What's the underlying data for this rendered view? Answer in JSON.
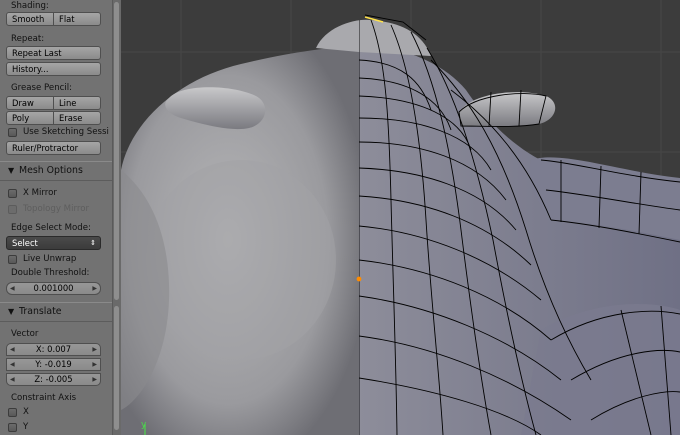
{
  "toolshelf": {
    "shading": {
      "label": "Shading:",
      "smooth": "Smooth",
      "flat": "Flat"
    },
    "repeat": {
      "label": "Repeat:",
      "repeat_last": "Repeat Last",
      "history": "History..."
    },
    "grease_pencil": {
      "label": "Grease Pencil:",
      "draw": "Draw",
      "line": "Line",
      "poly": "Poly",
      "erase": "Erase",
      "use_sketching": "Use Sketching Sessi",
      "ruler": "Ruler/Protractor"
    },
    "mesh_options": {
      "title": "Mesh Options",
      "x_mirror": "X Mirror",
      "topology_mirror": "Topology Mirror",
      "edge_select_label": "Edge Select Mode:",
      "edge_select_value": "Select",
      "live_unwrap": "Live Unwrap",
      "double_threshold_label": "Double Threshold:",
      "double_threshold_value": "0.001000"
    },
    "translate": {
      "title": "Translate",
      "vector_label": "Vector",
      "x": "X: 0.007",
      "y": "Y: -0.019",
      "z": "Z: -0.005",
      "constraint_label": "Constraint Axis",
      "cx": "X",
      "cy": "Y"
    }
  },
  "viewport": {
    "axis_label": "y",
    "grid_color": "#4a4a4a",
    "mesh_color": "#8a8aa0",
    "wire_color": "#000000",
    "vertex_color": "#ff8c00"
  }
}
